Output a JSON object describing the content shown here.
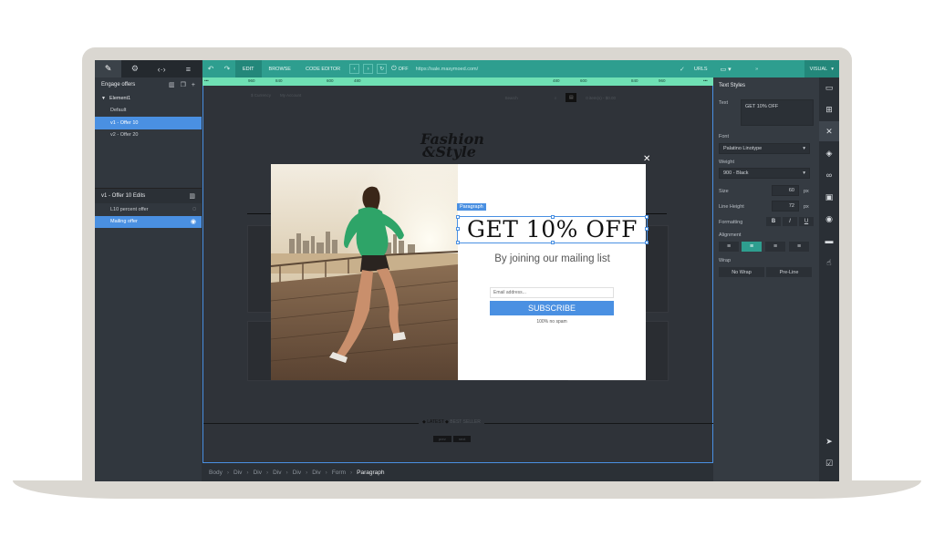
{
  "left_panel": {
    "tabs": [
      "✎",
      "⚙",
      "‹·›",
      "≡"
    ],
    "header": "Engage offers",
    "tree": [
      {
        "label": "Element1",
        "first": true
      },
      {
        "label": "Default"
      },
      {
        "label": "v1 - Offer 10",
        "selected": true
      },
      {
        "label": "v2 - Offer 20"
      }
    ],
    "edits_header": "v1 - Offer 10 Edits",
    "edits": [
      {
        "label": "L10 percent offer"
      },
      {
        "label": "Mailing offer",
        "selected": true
      }
    ]
  },
  "toolbar": {
    "edit": "EDIT",
    "browse": "BROWSE",
    "code_editor": "CODE EDITOR",
    "off": "OFF",
    "url": "https://sale.masymoed.com/",
    "urls": "URLS",
    "visual": "VISUAL"
  },
  "ruler": [
    "960",
    "840",
    "600",
    "480",
    "480",
    "600",
    "840",
    "960"
  ],
  "site": {
    "nav_left": [
      "$ Currency",
      "My Account"
    ],
    "search": "Search",
    "cart": "0 item(s) - $0.00",
    "logo_line1": "Fashion",
    "logo_line2": "&Style",
    "latest": "LATEST",
    "bestseller": "BEST SELLER",
    "pill_prev": "prev",
    "pill_next": "next"
  },
  "popup": {
    "tag": "Paragraph",
    "headline": "GET 10% OFF",
    "subline": "By joining our mailing list",
    "email_placeholder": "Email address...",
    "subscribe": "SUBSCRIBE",
    "nospam": "100% no spam"
  },
  "breadcrumbs": [
    "Body",
    "Div",
    "Div",
    "Div",
    "Div",
    "Div",
    "Form",
    "Paragraph"
  ],
  "right_panel": {
    "title": "Text Styles",
    "text_label": "Text",
    "text_value": "GET 10% OFF",
    "font_label": "Font",
    "font_value": "Palatino Linotype",
    "weight_label": "Weight",
    "weight_value": "900 - Black",
    "size_label": "Size",
    "size_value": "60",
    "line_height_label": "Line Height",
    "line_height_value": "72",
    "unit": "px",
    "formatting_label": "Formatting",
    "alignment_label": "Alignment",
    "wrap_label": "Wrap",
    "no_wrap": "No Wrap",
    "pre_line": "Pre-Line"
  },
  "colors": {
    "accent": "#4a90e2",
    "toolbar": "#2e9e8f",
    "ruler": "#6fe0b4"
  }
}
